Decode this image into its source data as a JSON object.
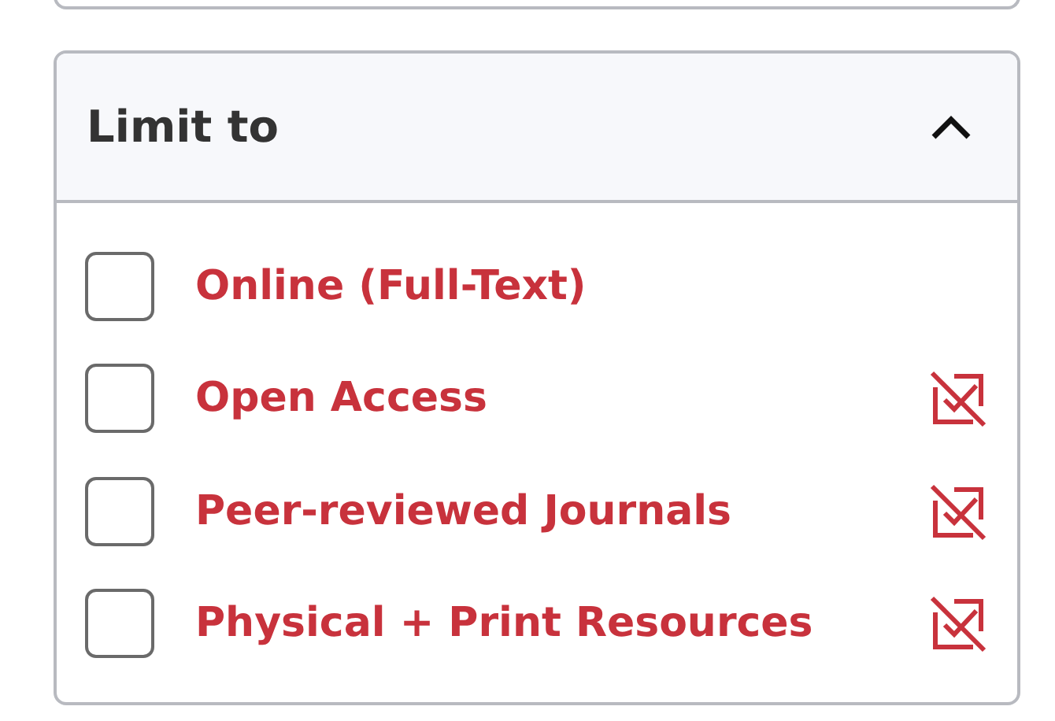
{
  "panel": {
    "title": "Limit to",
    "expanded": true,
    "options": [
      {
        "label": "Online (Full-Text)",
        "checked": false,
        "excludable": false
      },
      {
        "label": "Open Access",
        "checked": false,
        "excludable": true
      },
      {
        "label": "Peer-reviewed Journals",
        "checked": false,
        "excludable": true
      },
      {
        "label": "Physical + Print Resources",
        "checked": false,
        "excludable": true
      }
    ]
  }
}
